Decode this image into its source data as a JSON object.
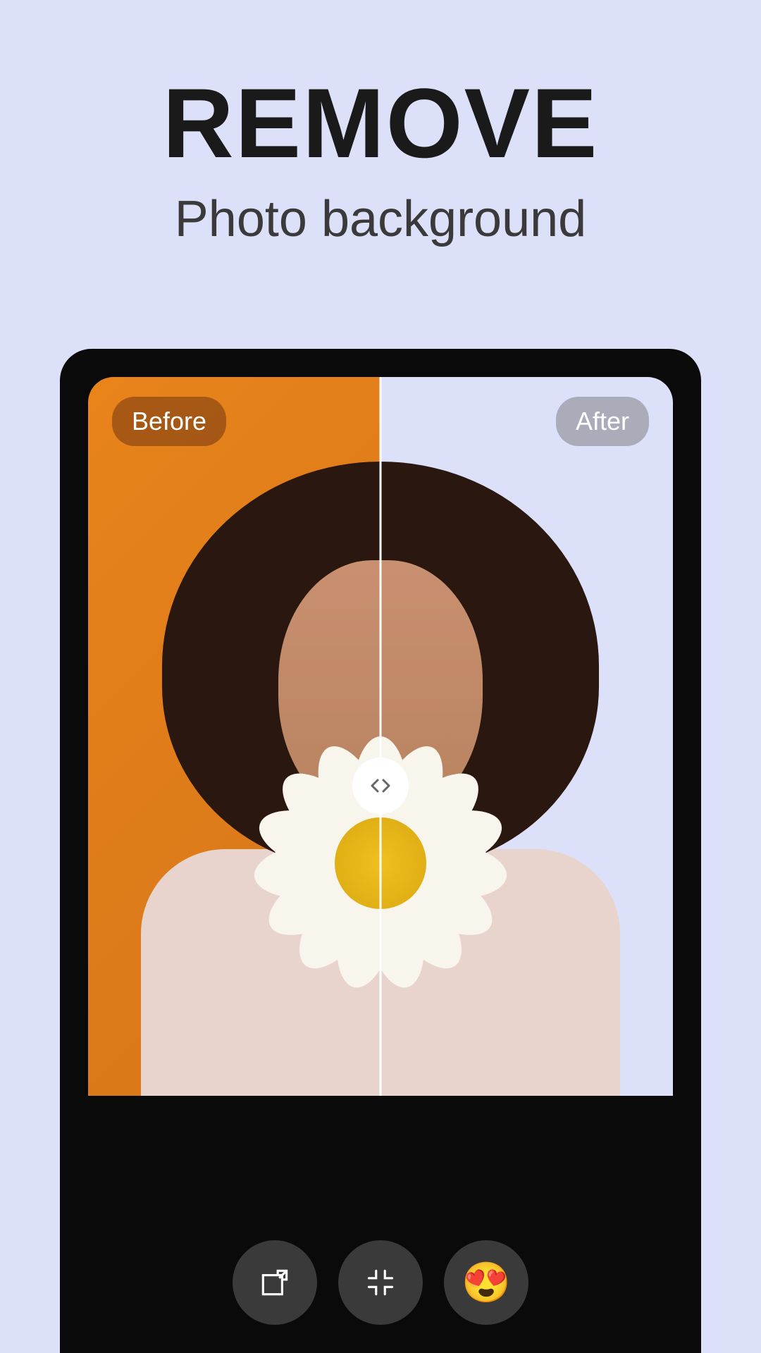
{
  "headline": {
    "main": "REMOVE",
    "sub": "Photo background"
  },
  "comparison": {
    "before_label": "Before",
    "after_label": "After"
  },
  "toolbar": {
    "expand_icon": "expand",
    "collapse_icon": "collapse",
    "emoji_icon": "😍"
  },
  "colors": {
    "page_bg": "#dce0f9",
    "phone_bg": "#0a0a0a",
    "before_bg": "#e8841a",
    "after_bg": "#dce0f9"
  }
}
